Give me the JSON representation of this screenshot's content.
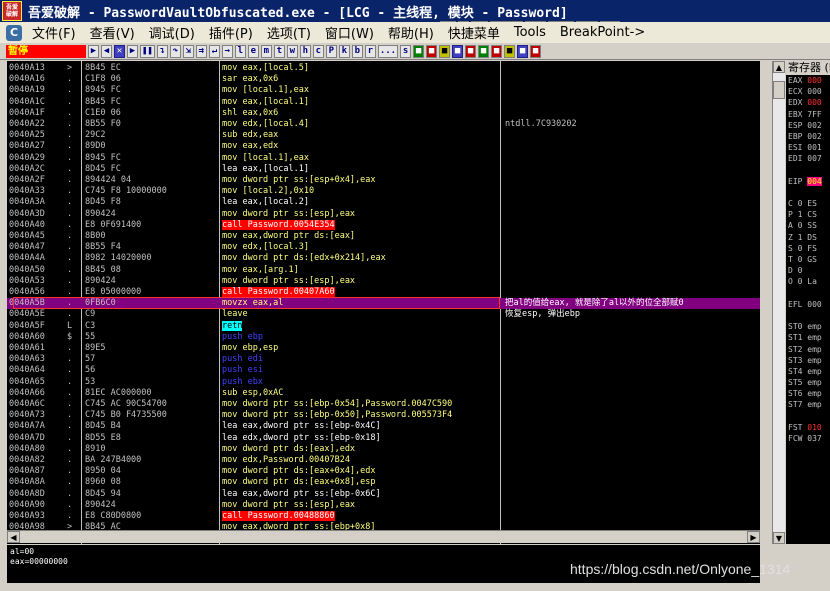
{
  "window": {
    "title": "吾爱破解 - PasswordVaultObfuscated.exe - [LCG - 主线程, 模块 - Password]",
    "app_icon_text": "吾爱破解",
    "plugin_buttons": [
      "BP",
      "P",
      "VB",
      "Notepad",
      "Calc",
      "Folder",
      "CMD",
      "Exit"
    ]
  },
  "menu": {
    "logo": "C",
    "items": [
      "文件(F)",
      "查看(V)",
      "调试(D)",
      "插件(P)",
      "选项(T)",
      "窗口(W)",
      "帮助(H)",
      "快捷菜单",
      "Tools",
      "BreakPoint->"
    ]
  },
  "toolbar": {
    "status": "暂停",
    "letters": [
      "l",
      "e",
      "m",
      "t",
      "w",
      "h",
      "c",
      "P",
      "k",
      "b",
      "r",
      "...",
      "s"
    ]
  },
  "registers_panel": {
    "title": "寄存器 (FPU)",
    "lines": [
      {
        "name": "EAX",
        "val": "000"
      },
      {
        "name": "ECX",
        "val": "000"
      },
      {
        "name": "EDX",
        "val": "000"
      },
      {
        "name": "EBX",
        "val": "7FF"
      },
      {
        "name": "ESP",
        "val": "002"
      },
      {
        "name": "EBP",
        "val": "002"
      },
      {
        "name": "ESI",
        "val": "001"
      },
      {
        "name": "EDI",
        "val": "007"
      },
      {
        "name": "",
        "val": ""
      },
      {
        "name": "EIP",
        "val": "004"
      },
      {
        "name": "",
        "val": ""
      },
      {
        "name": "C 0",
        "val": "ES"
      },
      {
        "name": "P 1",
        "val": "CS"
      },
      {
        "name": "A 0",
        "val": "SS"
      },
      {
        "name": "Z 1",
        "val": "DS"
      },
      {
        "name": "S 0",
        "val": "FS"
      },
      {
        "name": "T 0",
        "val": "GS"
      },
      {
        "name": "D 0",
        "val": ""
      },
      {
        "name": "O 0",
        "val": "La"
      },
      {
        "name": "",
        "val": ""
      },
      {
        "name": "EFL",
        "val": "000"
      },
      {
        "name": "",
        "val": ""
      },
      {
        "name": "ST0",
        "val": "emp"
      },
      {
        "name": "ST1",
        "val": "emp"
      },
      {
        "name": "ST2",
        "val": "emp"
      },
      {
        "name": "ST3",
        "val": "emp"
      },
      {
        "name": "ST4",
        "val": "emp"
      },
      {
        "name": "ST5",
        "val": "emp"
      },
      {
        "name": "ST6",
        "val": "emp"
      },
      {
        "name": "ST7",
        "val": "emp"
      },
      {
        "name": "",
        "val": ""
      },
      {
        "name": "FST",
        "val": "010"
      },
      {
        "name": "FCW",
        "val": "037"
      }
    ]
  },
  "disasm": [
    {
      "addr": "0040A13",
      "gut": ">",
      "hex": "8B45 EC",
      "asm": "mov eax,[local.5]",
      "cls": "mov",
      "cmt": ""
    },
    {
      "addr": "0040A16",
      "gut": ".",
      "hex": "C1F8 06",
      "asm": "sar eax,0x6",
      "cls": "mov",
      "cmt": ""
    },
    {
      "addr": "0040A19",
      "gut": ".",
      "hex": "8945 FC",
      "asm": "mov [local.1],eax",
      "cls": "mov",
      "cmt": ""
    },
    {
      "addr": "0040A1C",
      "gut": ".",
      "hex": "8B45 FC",
      "asm": "mov eax,[local.1]",
      "cls": "mov",
      "cmt": ""
    },
    {
      "addr": "0040A1F",
      "gut": ".",
      "hex": "C1E0 06",
      "asm": "shl eax,0x6",
      "cls": "mov",
      "cmt": ""
    },
    {
      "addr": "0040A22",
      "gut": ".",
      "hex": "8B55 F0",
      "asm": "mov edx,[local.4]",
      "cls": "mov",
      "cmt": "ntdll.7C930202"
    },
    {
      "addr": "0040A25",
      "gut": ".",
      "hex": "29C2",
      "asm": "sub edx,eax",
      "cls": "mov",
      "cmt": ""
    },
    {
      "addr": "0040A27",
      "gut": ".",
      "hex": "89D0",
      "asm": "mov eax,edx",
      "cls": "mov",
      "cmt": ""
    },
    {
      "addr": "0040A29",
      "gut": ".",
      "hex": "8945 FC",
      "asm": "mov [local.1],eax",
      "cls": "mov",
      "cmt": ""
    },
    {
      "addr": "0040A2C",
      "gut": ".",
      "hex": "8D45 FC",
      "asm": "lea eax,[local.1]",
      "cls": "lea",
      "cmt": ""
    },
    {
      "addr": "0040A2F",
      "gut": ".",
      "hex": "894424 04",
      "asm": "mov dword ptr ss:[esp+0x4],eax",
      "cls": "mov",
      "cmt": ""
    },
    {
      "addr": "0040A33",
      "gut": ".",
      "hex": "C745 F8 10000000",
      "asm": "mov [local.2],0x10",
      "cls": "mov",
      "cmt": ""
    },
    {
      "addr": "0040A3A",
      "gut": ".",
      "hex": "8D45 F8",
      "asm": "lea eax,[local.2]",
      "cls": "lea",
      "cmt": ""
    },
    {
      "addr": "0040A3D",
      "gut": ".",
      "hex": "890424",
      "asm": "mov dword ptr ss:[esp],eax",
      "cls": "mov",
      "cmt": ""
    },
    {
      "addr": "0040A40",
      "gut": ".",
      "hex": "E8 0F691400",
      "asm": "call Password.0054E354",
      "cls": "call",
      "cmt": ""
    },
    {
      "addr": "0040A45",
      "gut": ".",
      "hex": "8B00",
      "asm": "mov eax,dword ptr ds:[eax]",
      "cls": "mov",
      "cmt": ""
    },
    {
      "addr": "0040A47",
      "gut": ".",
      "hex": "8B55 F4",
      "asm": "mov edx,[local.3]",
      "cls": "mov",
      "cmt": ""
    },
    {
      "addr": "0040A4A",
      "gut": ".",
      "hex": "8982 14020000",
      "asm": "mov dword ptr ds:[edx+0x214],eax",
      "cls": "mov",
      "cmt": ""
    },
    {
      "addr": "0040A50",
      "gut": ".",
      "hex": "8B45 08",
      "asm": "mov eax,[arg.1]",
      "cls": "mov",
      "cmt": ""
    },
    {
      "addr": "0040A53",
      "gut": ".",
      "hex": "890424",
      "asm": "mov dword ptr ss:[esp],eax",
      "cls": "mov",
      "cmt": ""
    },
    {
      "addr": "0040A56",
      "gut": ".",
      "hex": "E8 05000000",
      "asm": "call Password.00407A60",
      "cls": "call",
      "cmt": ""
    },
    {
      "addr": "0040A5B",
      "gut": ".",
      "hex": "0FB6C0",
      "asm": "movzx eax,al",
      "cls": "mov",
      "cmt": "把al的值给eax, 就是除了al以外的位全部赋0",
      "sel": true
    },
    {
      "addr": "0040A5E",
      "gut": ".",
      "hex": "C9",
      "asm": "leave",
      "cls": "mov",
      "cmt": "恢复esp, 弹出ebp"
    },
    {
      "addr": "0040A5F",
      "gut": "L",
      "hex": "C3",
      "asm": "retn",
      "cls": "ret",
      "cmt": ""
    },
    {
      "addr": "0040A60",
      "gut": "$",
      "hex": "55",
      "asm": "push ebp",
      "cls": "push",
      "cmt": ""
    },
    {
      "addr": "0040A61",
      "gut": ".",
      "hex": "89E5",
      "asm": "mov ebp,esp",
      "cls": "mov",
      "cmt": ""
    },
    {
      "addr": "0040A63",
      "gut": ".",
      "hex": "57",
      "asm": "push edi",
      "cls": "push",
      "cmt": ""
    },
    {
      "addr": "0040A64",
      "gut": ".",
      "hex": "56",
      "asm": "push esi",
      "cls": "push",
      "cmt": ""
    },
    {
      "addr": "0040A65",
      "gut": ".",
      "hex": "53",
      "asm": "push ebx",
      "cls": "push",
      "cmt": ""
    },
    {
      "addr": "0040A66",
      "gut": ".",
      "hex": "81EC AC000000",
      "asm": "sub esp,0xAC",
      "cls": "mov",
      "cmt": ""
    },
    {
      "addr": "0040A6C",
      "gut": ".",
      "hex": "C745 AC 90C54700",
      "asm": "mov dword ptr ss:[ebp-0x54],Password.0047C590",
      "cls": "mov",
      "cmt": ""
    },
    {
      "addr": "0040A73",
      "gut": ".",
      "hex": "C745 B0 F4735500",
      "asm": "mov dword ptr ss:[ebp-0x50],Password.005573F4",
      "cls": "mov",
      "cmt": ""
    },
    {
      "addr": "0040A7A",
      "gut": ".",
      "hex": "8D45 B4",
      "asm": "lea eax,dword ptr ss:[ebp-0x4C]",
      "cls": "lea",
      "cmt": ""
    },
    {
      "addr": "0040A7D",
      "gut": ".",
      "hex": "8D55 E8",
      "asm": "lea edx,dword ptr ss:[ebp-0x18]",
      "cls": "lea",
      "cmt": ""
    },
    {
      "addr": "0040A80",
      "gut": ".",
      "hex": "8910",
      "asm": "mov dword ptr ds:[eax],edx",
      "cls": "mov",
      "cmt": ""
    },
    {
      "addr": "0040A82",
      "gut": ".",
      "hex": "BA 247B4000",
      "asm": "mov edx,Password.00407B24",
      "cls": "mov",
      "cmt": ""
    },
    {
      "addr": "0040A87",
      "gut": ".",
      "hex": "8950 04",
      "asm": "mov dword ptr ds:[eax+0x4],edx",
      "cls": "mov",
      "cmt": ""
    },
    {
      "addr": "0040A8A",
      "gut": ".",
      "hex": "8960 08",
      "asm": "mov dword ptr ds:[eax+0x8],esp",
      "cls": "mov",
      "cmt": ""
    },
    {
      "addr": "0040A8D",
      "gut": ".",
      "hex": "8D45 94",
      "asm": "lea eax,dword ptr ss:[ebp-0x6C]",
      "cls": "lea",
      "cmt": ""
    },
    {
      "addr": "0040A90",
      "gut": ".",
      "hex": "890424",
      "asm": "mov dword ptr ss:[esp],eax",
      "cls": "mov",
      "cmt": ""
    },
    {
      "addr": "0040A93",
      "gut": ".",
      "hex": "E8 C80D0800",
      "asm": "call Password.00488860",
      "cls": "call",
      "cmt": ""
    },
    {
      "addr": "0040A98",
      "gut": ">",
      "hex": "8B45 AC",
      "asm": "mov eax,dword ptr ss:[ebp+0x8]",
      "cls": "mov",
      "cmt": ""
    },
    {
      "addr": "0040A9B",
      "gut": ".",
      "hex": "8398 14020000 00",
      "asm": "cmp dword ptr ds:[eax+0x214],0x0",
      "cls": "cmp",
      "cmt": ""
    }
  ],
  "info_pane": {
    "line1": "al=00",
    "line2": "eax=00000000"
  },
  "watermark": "https://blog.csdn.net/Onlyone_1314",
  "colors": {
    "title_bg": "#0a246a",
    "pause": "#ff0000",
    "selection": "#800080",
    "call_bg": "#ff0000",
    "ret_bg": "#00ffff",
    "push": "#4040ff"
  }
}
